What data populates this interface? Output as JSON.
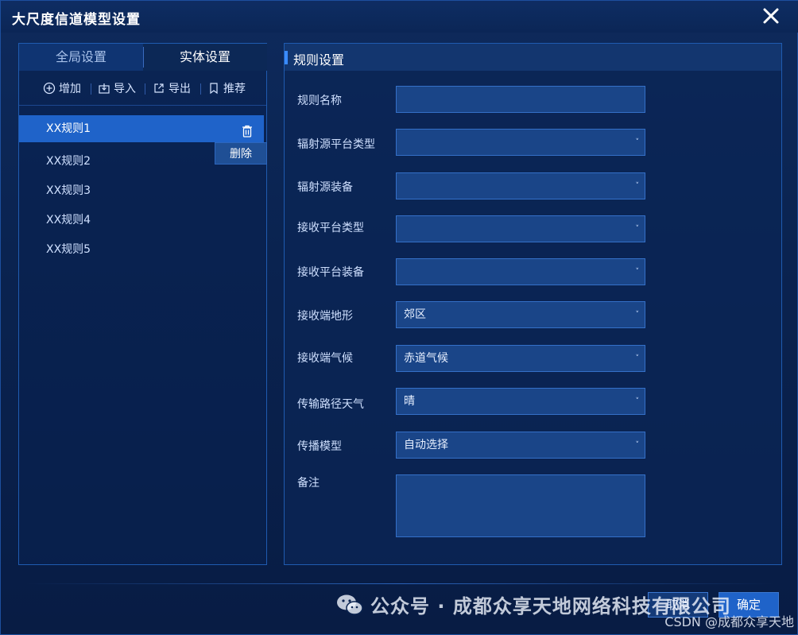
{
  "window": {
    "title": "大尺度信道模型设置",
    "close_icon": "close-icon"
  },
  "left": {
    "tabs": [
      {
        "label": "全局设置",
        "active": false
      },
      {
        "label": "实体设置",
        "active": true
      }
    ],
    "toolbar": {
      "add": "增加",
      "import": "导入",
      "export": "导出",
      "recommend": "推荐"
    },
    "rules": [
      {
        "label": "XX规则1",
        "selected": true
      },
      {
        "label": "XX规则2",
        "selected": false
      },
      {
        "label": "XX规则3",
        "selected": false
      },
      {
        "label": "XX规则4",
        "selected": false
      },
      {
        "label": "XX规则5",
        "selected": false
      }
    ],
    "delete_tooltip": "删除"
  },
  "right": {
    "section_title": "规则设置",
    "fields": [
      {
        "label": "规则名称",
        "type": "input",
        "value": ""
      },
      {
        "label": "辐射源平台类型",
        "type": "select",
        "value": ""
      },
      {
        "label": "辐射源装备",
        "type": "select",
        "value": ""
      },
      {
        "label": "接收平台类型",
        "type": "select",
        "value": ""
      },
      {
        "label": "接收平台装备",
        "type": "select",
        "value": ""
      },
      {
        "label": "接收端地形",
        "type": "select",
        "value": "郊区"
      },
      {
        "label": "接收端气候",
        "type": "select",
        "value": "赤道气候"
      },
      {
        "label": "传输路径天气",
        "type": "select",
        "value": "晴"
      },
      {
        "label": "传播模型",
        "type": "select",
        "value": "自动选择"
      },
      {
        "label": "备注",
        "type": "textarea",
        "value": ""
      }
    ],
    "caret": "˅"
  },
  "footer": {
    "cancel": "取消",
    "ok": "确定"
  },
  "watermark": {
    "text": "公众号 · 成都众享天地网络科技有限公司",
    "csdn": "CSDN @成都众享天地"
  },
  "colors": {
    "accent": "#1f63c9",
    "panel_border": "#1f5bb0",
    "background": "#0a2350"
  }
}
